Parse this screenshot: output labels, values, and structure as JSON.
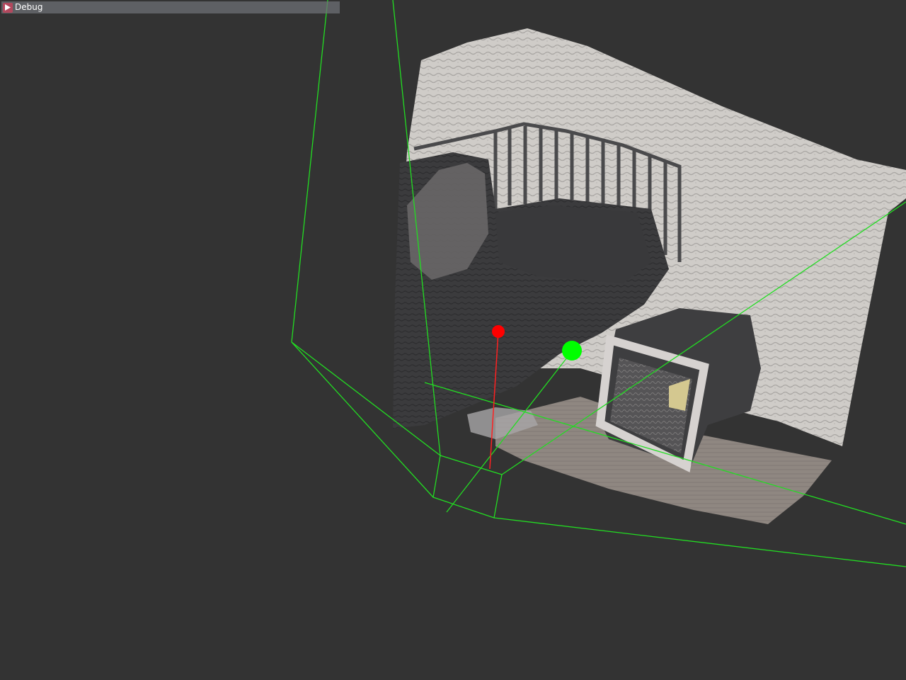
{
  "debug_window": {
    "title": "Debug",
    "collapse_icon": "triangle-right-icon",
    "accent_color": "#b2485d"
  },
  "scene": {
    "background_color": "#333333",
    "frustum_color": "#22dd22",
    "markers": [
      {
        "name": "red-marker",
        "color": "#ff0000"
      },
      {
        "name": "green-marker",
        "color": "#00ff00"
      }
    ]
  }
}
